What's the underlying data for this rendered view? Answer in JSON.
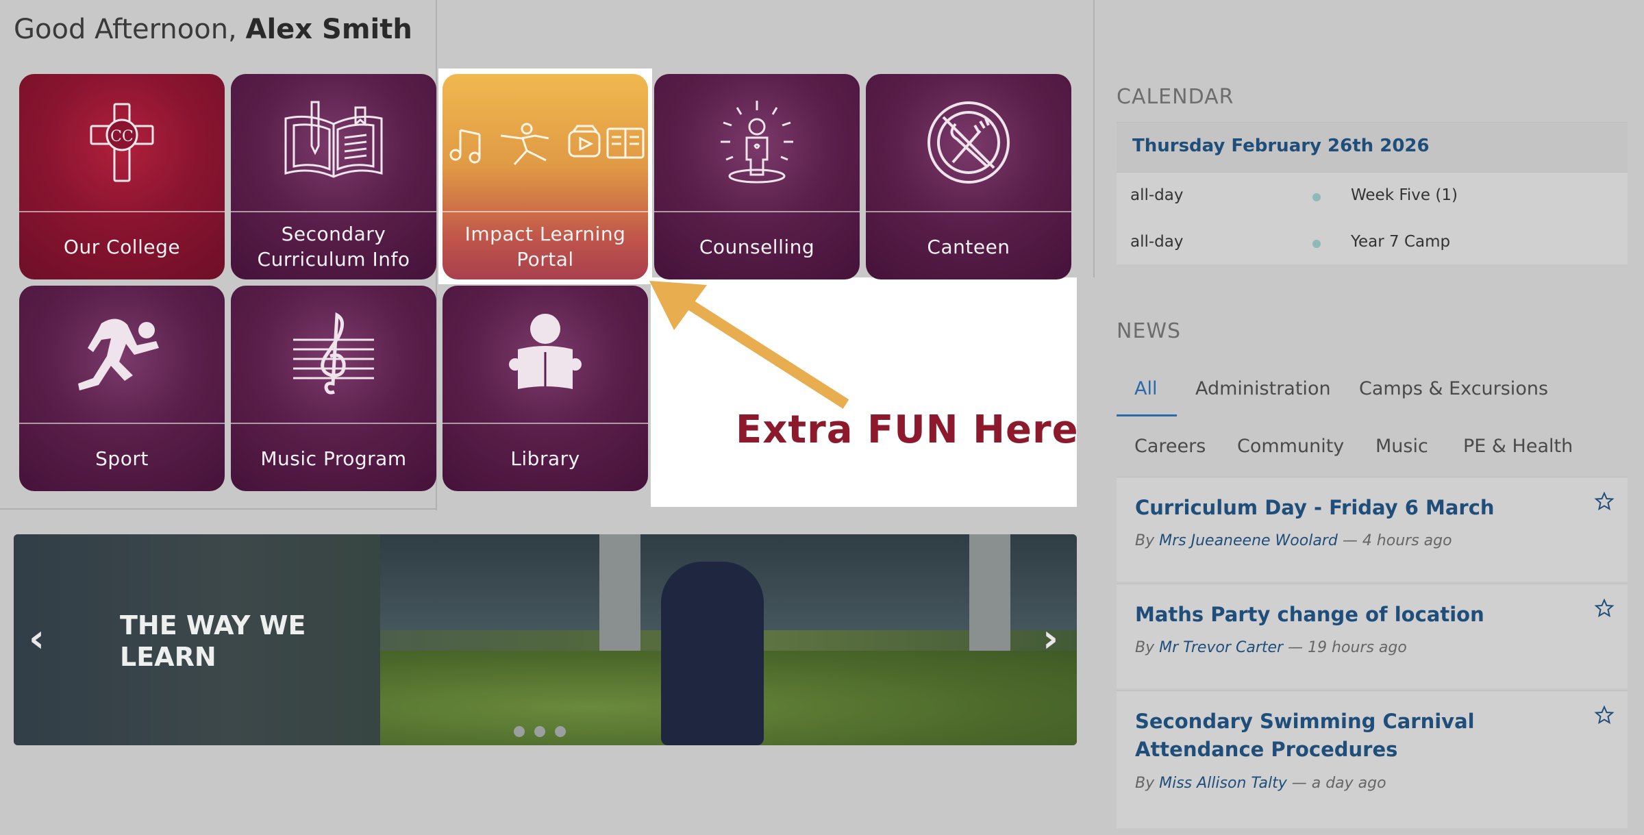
{
  "greeting": {
    "prefix": "Good Afternoon,",
    "name": "Alex Smith"
  },
  "tiles": [
    {
      "label": "Our College",
      "icon": "college-crest-icon"
    },
    {
      "label": "Secondary Curriculum Info",
      "icon": "open-book-icon"
    },
    {
      "label": "Impact Learning Portal",
      "icon": "learning-portal-icons"
    },
    {
      "label": "Counselling",
      "icon": "person-radiating-icon"
    },
    {
      "label": "Canteen",
      "icon": "no-cutlery-icon"
    },
    {
      "label": "Sport",
      "icon": "runner-icon"
    },
    {
      "label": "Music Program",
      "icon": "treble-clef-icon"
    },
    {
      "label": "Library",
      "icon": "reader-icon"
    }
  ],
  "annotation": {
    "text": "Extra FUN Here"
  },
  "carousel": {
    "title": "THE WAY WE LEARN",
    "prev": "‹",
    "next": "›",
    "slide_count": 3
  },
  "calendar": {
    "heading": "CALENDAR",
    "date": "Thursday February 26th 2026",
    "events": [
      {
        "when": "all-day",
        "what": "Week Five (1)"
      },
      {
        "when": "all-day",
        "what": "Year 7 Camp"
      }
    ]
  },
  "news": {
    "heading": "NEWS",
    "tabs": [
      "All",
      "Administration",
      "Camps & Excursions",
      "Careers",
      "Community",
      "Music",
      "PE & Health"
    ],
    "active_tab": "All",
    "items": [
      {
        "title": "Curriculum Day - Friday 6 March",
        "by": "By",
        "author": "Mrs Jueaneene Woolard",
        "time": "— 4 hours ago"
      },
      {
        "title": "Maths Party change of location",
        "by": "By",
        "author": "Mr Trevor Carter",
        "time": "— 19 hours ago"
      },
      {
        "title": "Secondary Swimming Carnival Attendance Procedures",
        "by": "By",
        "author": "Miss Allison Talty",
        "time": "— a day ago"
      }
    ]
  },
  "colors": {
    "accent": "#1f4e7a",
    "tile": "#5a1f4a",
    "tile_red": "#8a1430",
    "tile_gold": "#e09a45",
    "annotation": "#8c1a2c",
    "arrow": "#e8ad4f"
  }
}
